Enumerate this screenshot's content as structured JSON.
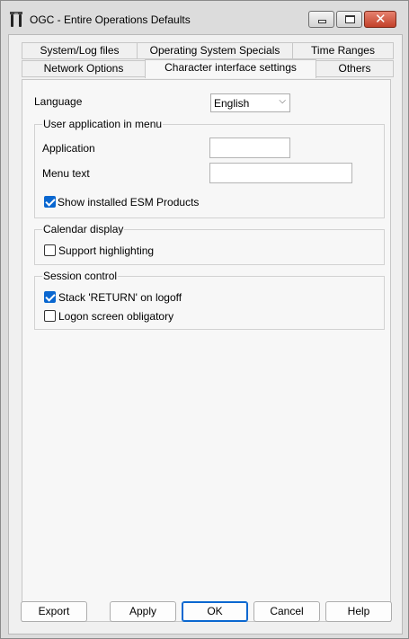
{
  "window": {
    "title": "OGC - Entire Operations Defaults",
    "icon": "app-icon",
    "controls": [
      "minimize-icon",
      "maximize-icon",
      "close-icon"
    ]
  },
  "tabs": {
    "row1": [
      "System/Log files",
      "Operating System Specials",
      "Time Ranges"
    ],
    "row2": [
      "Network Options",
      "Character interface settings",
      "Others"
    ],
    "active": "Character interface settings"
  },
  "language": {
    "label": "Language",
    "value": "English"
  },
  "user_app": {
    "title": "User application in menu",
    "application_label": "Application",
    "application_value": "",
    "menu_text_label": "Menu text",
    "menu_text_value": "",
    "show_esm_label": "Show installed ESM Products",
    "show_esm_checked": true
  },
  "calendar": {
    "title": "Calendar display",
    "support_highlighting_label": "Support highlighting",
    "support_highlighting_checked": false
  },
  "session": {
    "title": "Session control",
    "stack_return_label": "Stack 'RETURN' on logoff",
    "stack_return_checked": true,
    "logon_obligatory_label": "Logon screen obligatory",
    "logon_obligatory_checked": false
  },
  "buttons": {
    "export": "Export",
    "apply": "Apply",
    "ok": "OK",
    "cancel": "Cancel",
    "help": "Help"
  },
  "colors": {
    "accent": "#0a67d0",
    "close_button": "#c2412a"
  }
}
